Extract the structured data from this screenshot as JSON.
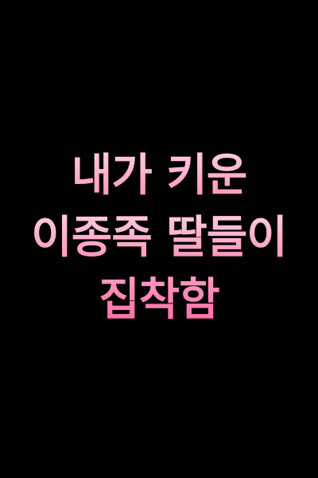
{
  "title": {
    "line1": "내가 키운",
    "line2": "이종족 딸들이",
    "line3": "집착함"
  },
  "colors": {
    "background": "#000000",
    "text_top": "#ffd0e2",
    "text_bottom": "#ff6aa2"
  }
}
